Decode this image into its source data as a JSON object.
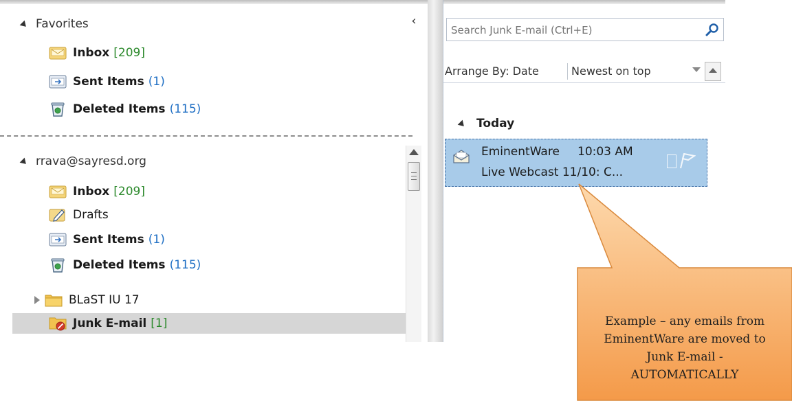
{
  "nav": {
    "collapse_glyph": "‹",
    "favorites": {
      "title": "Favorites",
      "items": [
        {
          "name": "Inbox",
          "count": "[209]",
          "icon": "inbox-icon"
        },
        {
          "name": "Sent Items",
          "count": "(1)",
          "icon": "sent-items-icon"
        },
        {
          "name": "Deleted Items",
          "count": "(115)",
          "icon": "deleted-items-icon"
        }
      ]
    },
    "account": {
      "title": "rrava@sayresd.org",
      "items": [
        {
          "name": "Inbox",
          "count": "[209]",
          "icon": "inbox-icon"
        },
        {
          "name": "Drafts",
          "count": "",
          "icon": "drafts-icon"
        },
        {
          "name": "Sent Items",
          "count": "(1)",
          "icon": "sent-items-icon"
        },
        {
          "name": "Deleted Items",
          "count": "(115)",
          "icon": "deleted-items-icon"
        },
        {
          "name": "BLaST IU 17",
          "count": "",
          "icon": "folder-icon"
        },
        {
          "name": "Junk E-mail",
          "count": "[1]",
          "icon": "junk-email-icon"
        }
      ]
    }
  },
  "list": {
    "search_placeholder": "Search Junk E-mail (Ctrl+E)",
    "arrange_label": "Arrange By: Date",
    "sort_label": "Newest on top",
    "group": "Today",
    "messages": [
      {
        "sender": "EminentWare",
        "time": "10:03 AM",
        "subject": "Live Webcast 11/10: C..."
      }
    ]
  },
  "callout": {
    "text": "Example – any emails from EminentWare are moved to Junk E-mail - AUTOMATICALLY"
  },
  "colors": {
    "selected_message": "#a8cbe9",
    "count_green": "#2d8a2d",
    "count_blue": "#1f6fc4",
    "callout_fill": "#f8b171"
  }
}
